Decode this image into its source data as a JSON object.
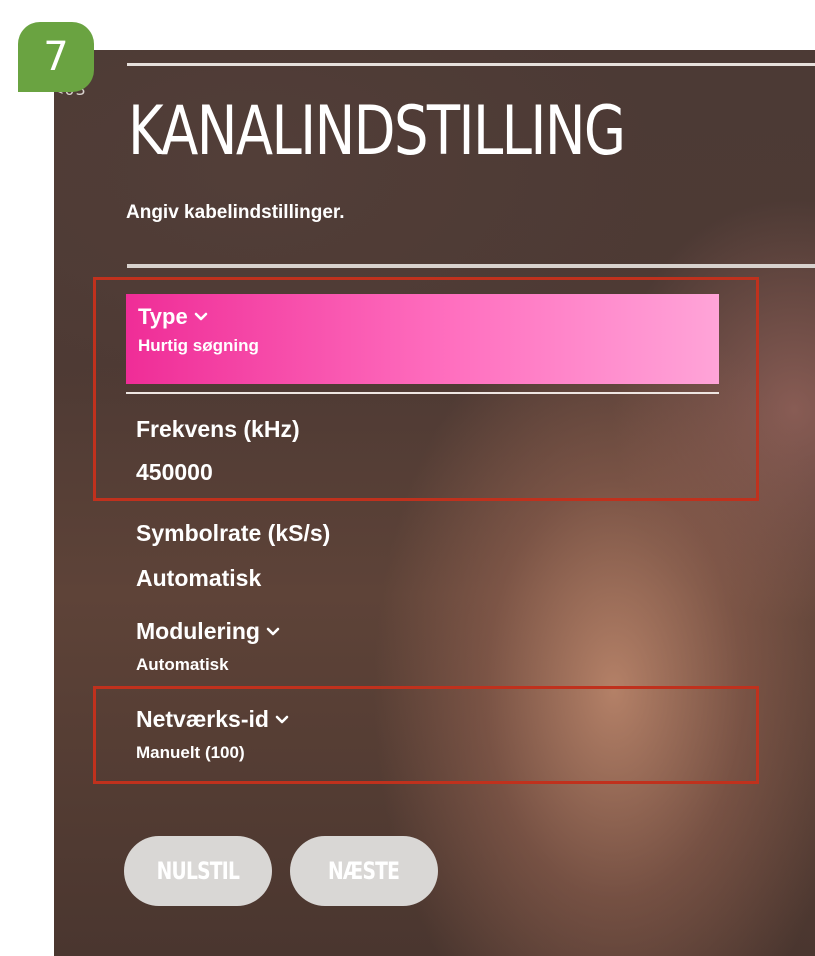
{
  "step_badge": "7",
  "nav": {
    "back_arrow": "<",
    "step_count": "03"
  },
  "screen": {
    "title": "KANALINDSTILLING",
    "subtitle": "Angiv kabelindstillinger."
  },
  "settings": {
    "type": {
      "label": "Type",
      "value": "Hurtig søgning",
      "selected": true
    },
    "frequency": {
      "label": "Frekvens (kHz)",
      "value": "450000"
    },
    "symbolrate": {
      "label": "Symbolrate (kS/s)",
      "value": "Automatisk"
    },
    "modulation": {
      "label": "Modulering",
      "value": "Automatisk"
    },
    "network_id": {
      "label": "Netværks-id",
      "value": "Manuelt (100)"
    }
  },
  "buttons": {
    "reset": "NULSTIL",
    "next": "NÆSTE"
  },
  "colors": {
    "badge": "#6aa341",
    "selected_gradient_start": "#ef2d97",
    "selected_gradient_end": "#ffa4d8",
    "highlight_box": "#c0311d",
    "button_bg": "#d9d7d5"
  },
  "icons": {
    "dropdown": "chevron-down-icon"
  }
}
